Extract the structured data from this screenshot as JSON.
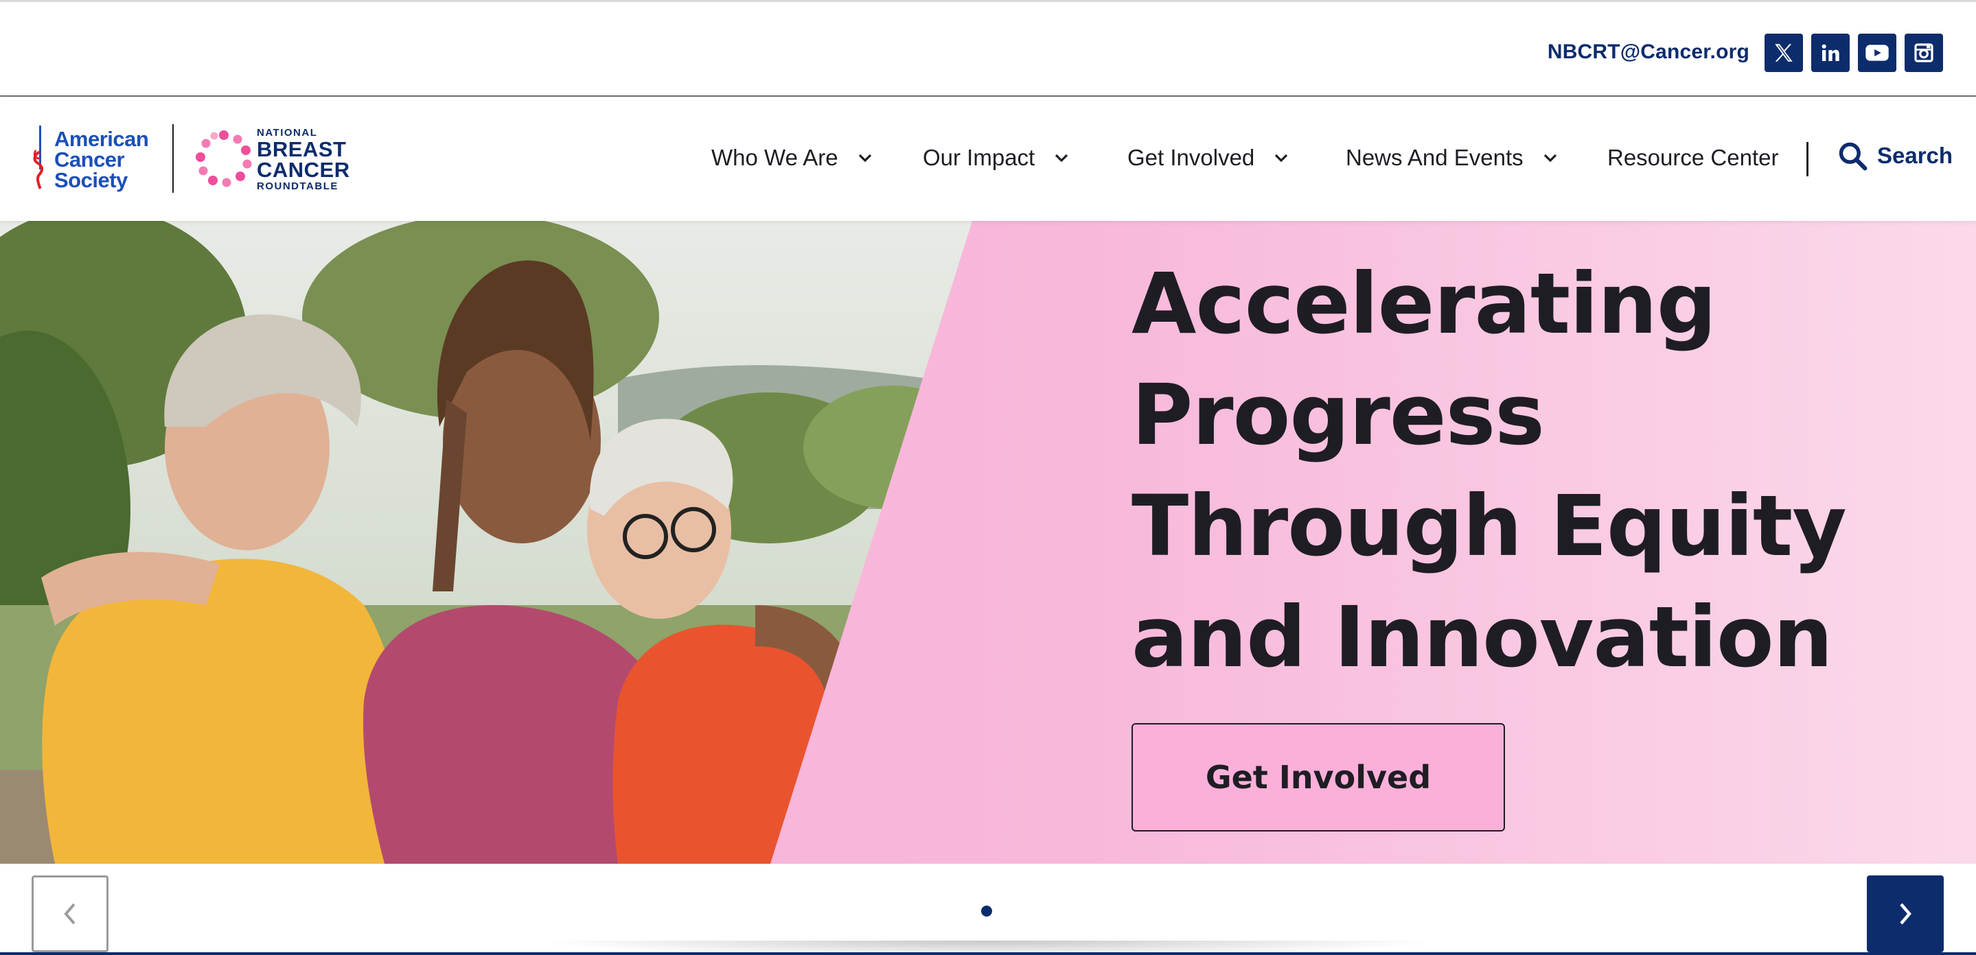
{
  "topbar": {
    "email": "NBCRT@Cancer.org",
    "social": [
      {
        "icon": "x-twitter-icon"
      },
      {
        "icon": "linkedin-icon"
      },
      {
        "icon": "youtube-icon"
      },
      {
        "icon": "instagram-icon"
      }
    ]
  },
  "header": {
    "acs_logo": {
      "line1": "American",
      "line2": "Cancer",
      "line3": "Society"
    },
    "nbcrt_logo": {
      "line1": "NATIONAL",
      "line2": "BREAST",
      "line3": "CANCER",
      "line4": "ROUNDTABLE"
    },
    "nav": [
      {
        "label": "Who We Are",
        "has_dropdown": true
      },
      {
        "label": "Our Impact",
        "has_dropdown": true
      },
      {
        "label": "Get Involved",
        "has_dropdown": true
      },
      {
        "label": "News And Events",
        "has_dropdown": true
      },
      {
        "label": "Resource Center",
        "has_dropdown": false
      }
    ],
    "search_label": "Search"
  },
  "hero": {
    "title_lines": [
      "Accelerating",
      "Progress",
      "Through Equity",
      "and Innovation"
    ],
    "cta_label": "Get Involved",
    "photo": "three smiling women embracing outdoors"
  },
  "carousel": {
    "slide_count": 1,
    "active_slide": 1
  },
  "colors": {
    "navy": "#0d2c6c",
    "acs_blue": "#1c4fb8",
    "pink": "#f9b0d8",
    "text": "#1f1d24"
  }
}
